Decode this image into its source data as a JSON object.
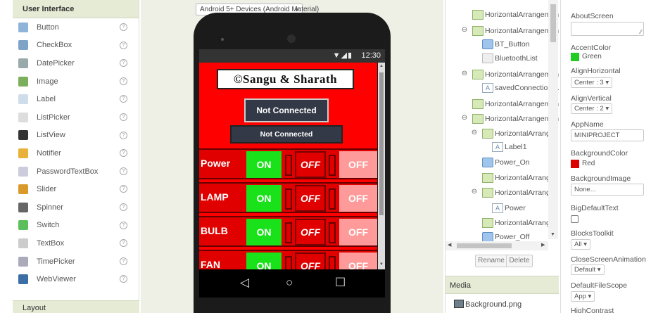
{
  "palette": {
    "header": "User Interface",
    "items": [
      {
        "label": "Button",
        "icon": "button-icon",
        "color": "#8fb4d9"
      },
      {
        "label": "CheckBox",
        "icon": "checkbox-icon",
        "color": "#7ea3c9"
      },
      {
        "label": "DatePicker",
        "icon": "calendar-icon",
        "color": "#9aa"
      },
      {
        "label": "Image",
        "icon": "image-icon",
        "color": "#7caf5c"
      },
      {
        "label": "Label",
        "icon": "label-icon",
        "color": "#cfdcea"
      },
      {
        "label": "ListPicker",
        "icon": "listpicker-icon",
        "color": "#ddd"
      },
      {
        "label": "ListView",
        "icon": "listview-icon",
        "color": "#333"
      },
      {
        "label": "Notifier",
        "icon": "warning-icon",
        "color": "#e8b23a"
      },
      {
        "label": "PasswordTextBox",
        "icon": "password-icon",
        "color": "#ccd"
      },
      {
        "label": "Slider",
        "icon": "slider-icon",
        "color": "#d99a2b"
      },
      {
        "label": "Spinner",
        "icon": "spinner-icon",
        "color": "#666"
      },
      {
        "label": "Switch",
        "icon": "switch-icon",
        "color": "#5bbf5b"
      },
      {
        "label": "TextBox",
        "icon": "textbox-icon",
        "color": "#ccc"
      },
      {
        "label": "TimePicker",
        "icon": "clock-icon",
        "color": "#aab"
      },
      {
        "label": "WebViewer",
        "icon": "globe-icon",
        "color": "#3a6ea5"
      }
    ],
    "help_glyph": "?",
    "footer": "Layout"
  },
  "viewer": {
    "device_select": "Android 5+ Devices (Android Material)",
    "status_time": "12:30",
    "status_icons": "▼◢▮",
    "title": "©Sangu & Sharath",
    "not_connected_1": "Not Connected",
    "not_connected_2": "Not Connected",
    "rows": [
      {
        "name": "Power",
        "on": "ON",
        "off1": "OFF",
        "off2": "OFF"
      },
      {
        "name": "LAMP",
        "on": "ON",
        "off1": "OFF",
        "off2": "OFF"
      },
      {
        "name": "BULB",
        "on": "ON",
        "off1": "OFF",
        "off2": "OFF"
      },
      {
        "name": "FAN",
        "on": "ON",
        "off1": "OFF",
        "off2": "OFF"
      }
    ],
    "nav": {
      "back": "◁",
      "home": "○",
      "recent": "☐"
    }
  },
  "components": {
    "toggle_glyph": "⊖",
    "nodes": [
      {
        "label": "HorizontalArrangemen",
        "icon": "ha"
      },
      {
        "label": "HorizontalArrangemen",
        "icon": "ha"
      },
      {
        "label": "BT_Button",
        "icon": "btn"
      },
      {
        "label": "BluetoothList",
        "icon": "lst"
      },
      {
        "label": "HorizontalArrangemen",
        "icon": "ha"
      },
      {
        "label": "savedConnection_L",
        "icon": "lbl"
      },
      {
        "label": "HorizontalArrangemen",
        "icon": "ha"
      },
      {
        "label": "HorizontalArrangemen",
        "icon": "ha"
      },
      {
        "label": "HorizontalArrangen",
        "icon": "ha"
      },
      {
        "label": "Label1",
        "icon": "lbl"
      },
      {
        "label": "Power_On",
        "icon": "btn"
      },
      {
        "label": "HorizontalArrangen",
        "icon": "ha"
      },
      {
        "label": "HorizontalArrangen",
        "icon": "ha"
      },
      {
        "label": "Power",
        "icon": "lbl"
      },
      {
        "label": "HorizontalArrangen",
        "icon": "ha"
      },
      {
        "label": "Power_Off",
        "icon": "btn"
      }
    ],
    "rename": "Rename",
    "delete": "Delete"
  },
  "media": {
    "header": "Media",
    "file": "Background.png"
  },
  "properties": {
    "about_screen": "AboutScreen",
    "accent_color": "AccentColor",
    "accent_value": "Green",
    "accent_hex": "#22cc22",
    "align_h": "AlignHorizontal",
    "align_h_value": "Center : 3 ▾",
    "align_v": "AlignVertical",
    "align_v_value": "Center : 2 ▾",
    "app_name": "AppName",
    "app_name_value": "MINIPROJECT",
    "bg_color": "BackgroundColor",
    "bg_color_value": "Red",
    "bg_color_hex": "#dd0000",
    "bg_image": "BackgroundImage",
    "bg_image_value": "None...",
    "big_text": "BigDefaultText",
    "blocks_toolkit": "BlocksToolkit",
    "blocks_value": "All ▾",
    "close_anim": "CloseScreenAnimation",
    "close_anim_value": "Default ▾",
    "file_scope": "DefaultFileScope",
    "file_scope_value": "App ▾",
    "high_contrast": "HighContrast"
  }
}
